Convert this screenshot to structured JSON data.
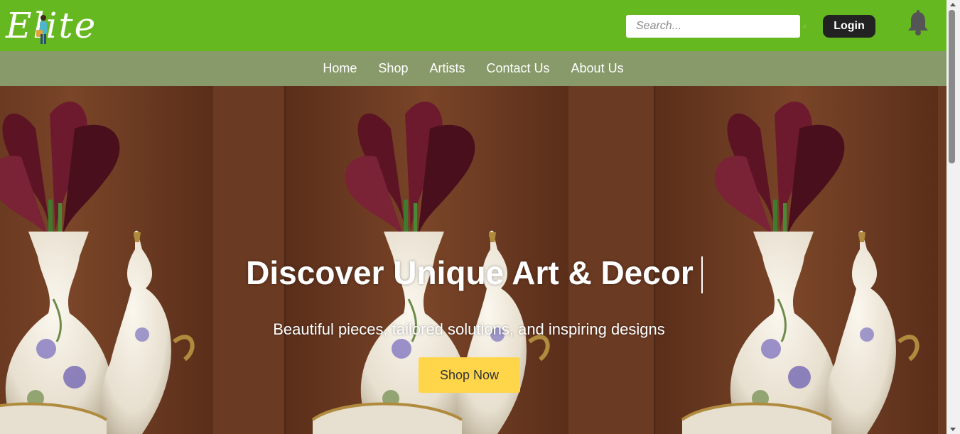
{
  "header": {
    "logo_text": "Elite",
    "search_placeholder": "Search...",
    "search_clear": "×",
    "login_label": "Login",
    "bell_icon": "bell-icon"
  },
  "nav": {
    "items": [
      {
        "label": "Home"
      },
      {
        "label": "Shop"
      },
      {
        "label": "Artists"
      },
      {
        "label": "Contact Us"
      },
      {
        "label": "About Us"
      }
    ]
  },
  "hero": {
    "title": "Discover Unique Art & Decor",
    "subtitle": "Beautiful pieces, tailored solutions, and inspiring designs",
    "cta_label": "Shop Now"
  },
  "colors": {
    "header_green": "#66b820",
    "nav_olive": "#889a6a",
    "cta_yellow": "#ffd54a",
    "login_dark": "#222222",
    "hero_wall": "#6b3a22"
  }
}
